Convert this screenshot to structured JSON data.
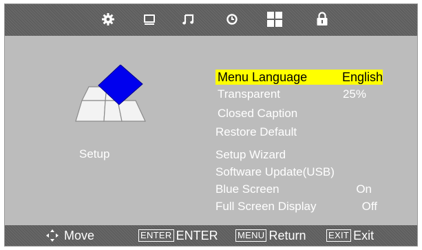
{
  "tabs": [
    {
      "icon": "gear-icon",
      "active": true
    },
    {
      "icon": "monitor-icon",
      "active": false
    },
    {
      "icon": "music-note-icon",
      "active": false
    },
    {
      "icon": "clock-icon",
      "active": false
    },
    {
      "icon": "grid-icon",
      "active": false
    },
    {
      "icon": "lock-icon",
      "active": false
    }
  ],
  "panel": {
    "title": "Setup"
  },
  "menu": [
    {
      "label": "Menu Language",
      "value": "English",
      "selected": true
    },
    {
      "label": "Transparent",
      "value": "25%"
    },
    {
      "label": "Closed Caption",
      "value": ""
    },
    {
      "label": "Restore Default",
      "value": ""
    },
    {
      "label": "Setup Wizard",
      "value": ""
    },
    {
      "label": "Software Update(USB)",
      "value": ""
    },
    {
      "label": "Blue Screen",
      "value": "On"
    },
    {
      "label": "Full Screen Display",
      "value": "Off"
    }
  ],
  "footer": {
    "move_label": "Move",
    "enter_key": "ENTER",
    "enter_label": "ENTER",
    "menu_key": "MENU",
    "return_label": "Return",
    "exit_key": "EXIT",
    "exit_label": "Exit"
  },
  "colors": {
    "highlight": "#ffff00",
    "background": "#bcbcbc",
    "bar": "#5e5e5e",
    "accent": "#0000ee"
  }
}
